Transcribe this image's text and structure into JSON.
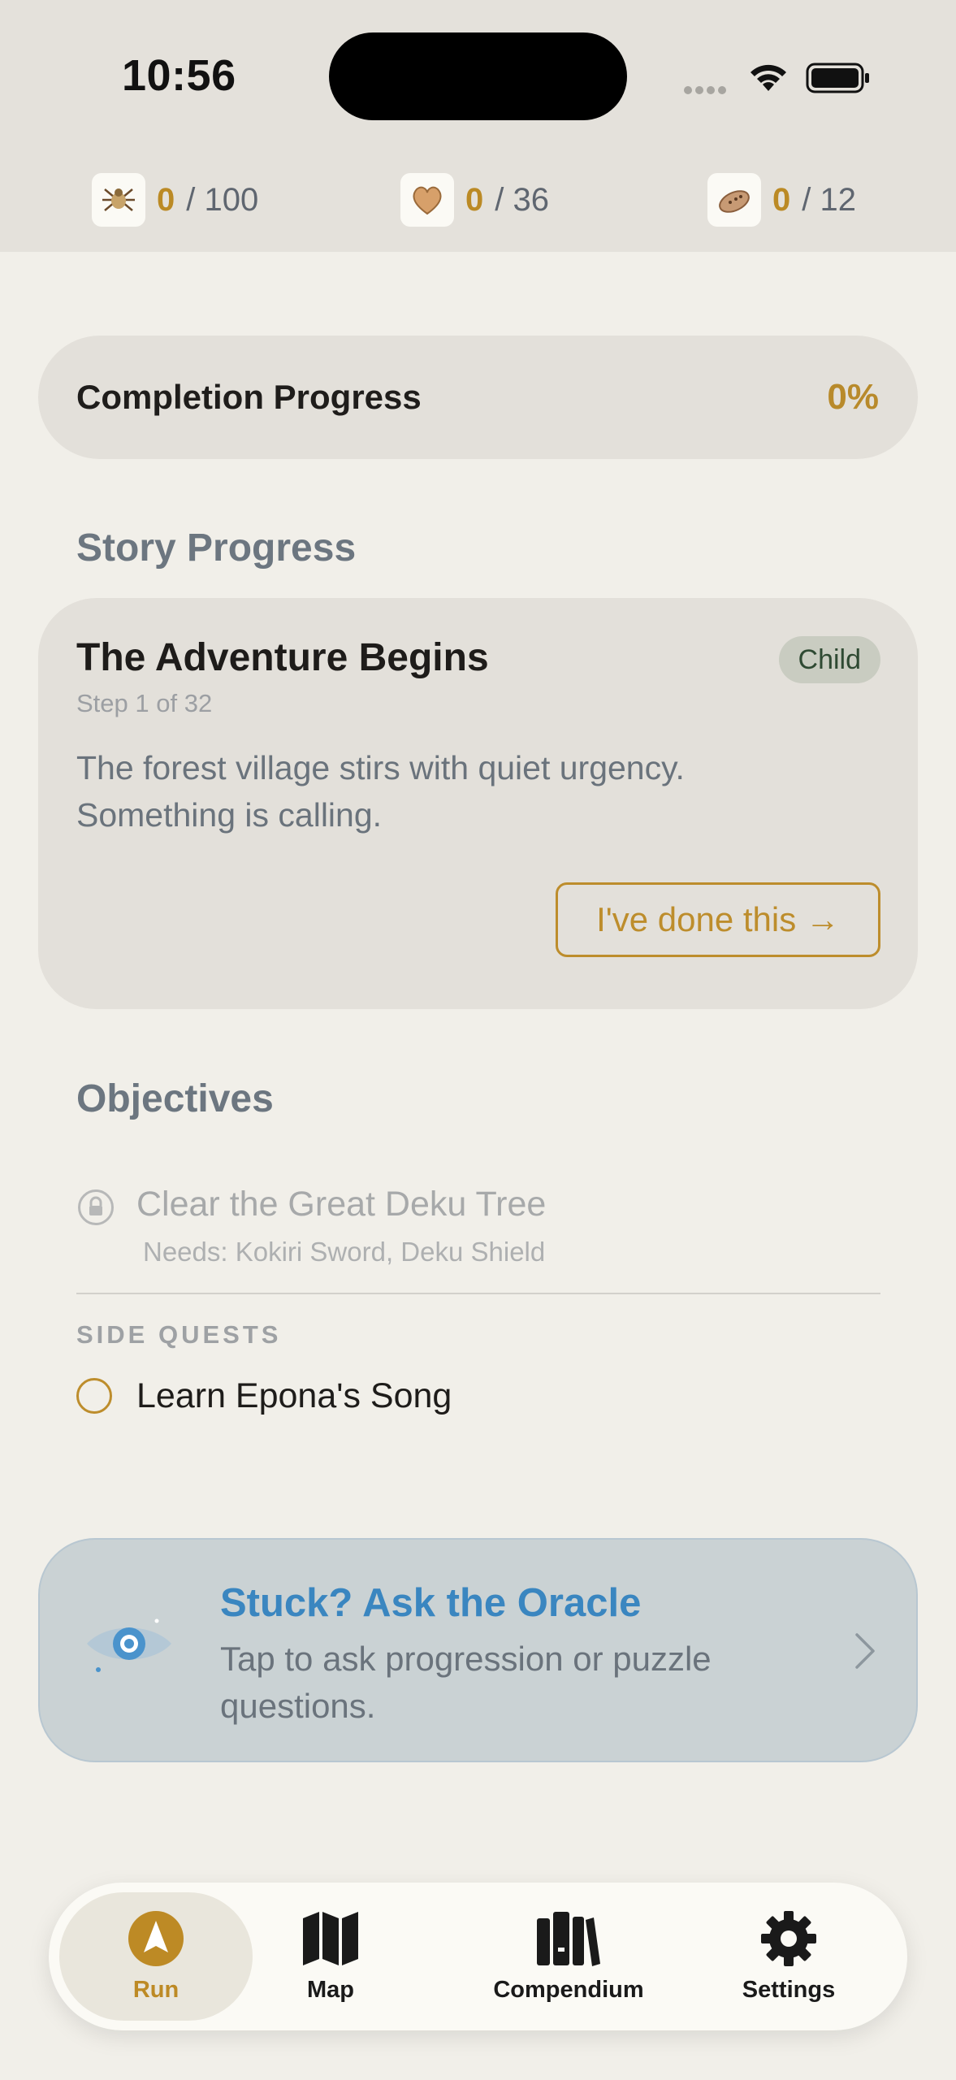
{
  "status_bar": {
    "time": "10:56"
  },
  "counters": [
    {
      "icon": "spider-icon",
      "have": "0",
      "total": "/ 100"
    },
    {
      "icon": "heart-piece-icon",
      "have": "0",
      "total": "/ 36"
    },
    {
      "icon": "ocarina-icon",
      "have": "0",
      "total": "/ 12"
    }
  ],
  "completion": {
    "label": "Completion Progress",
    "percent": "0%"
  },
  "story": {
    "section_title": "Story Progress",
    "title": "The Adventure Begins",
    "badge": "Child",
    "step": "Step 1 of 32",
    "description": "The forest village stirs with quiet urgency. Something is calling.",
    "done_button": "I've done this →"
  },
  "objectives": {
    "section_title": "Objectives",
    "locked": {
      "label": "Clear the Great Deku Tree",
      "needs": "Needs: Kokiri Sword, Deku Shield"
    },
    "side_quests_title": "SIDE QUESTS",
    "side_quests": [
      {
        "label": "Learn Epona's Song"
      }
    ]
  },
  "oracle": {
    "title": "Stuck? Ask the Oracle",
    "subtitle": "Tap to ask progression or puzzle questions."
  },
  "tabs": [
    {
      "label": "Run",
      "icon": "run-compass-icon",
      "active": true
    },
    {
      "label": "Map",
      "icon": "map-icon",
      "active": false
    },
    {
      "label": "Compendium",
      "icon": "books-icon",
      "active": false
    },
    {
      "label": "Settings",
      "icon": "gear-icon",
      "active": false
    }
  ],
  "colors": {
    "accent_gold": "#bd8d2c",
    "oracle_blue": "#3a86c0",
    "badge_green": "#2f4a33"
  }
}
